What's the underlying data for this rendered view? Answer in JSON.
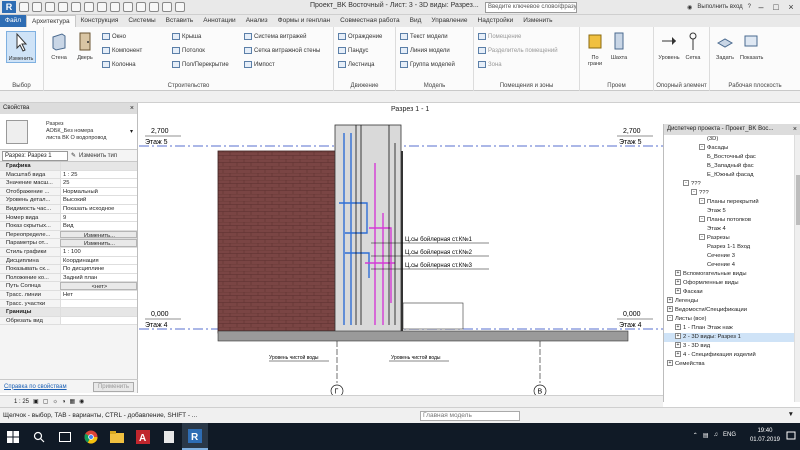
{
  "titlebar": {
    "title": "Проект_BK Восточный - Лист: 3 - 3D виды: Разрез...",
    "search_placeholder": "Введите ключевое слово/фразу",
    "user": "Выполнить вход"
  },
  "ribbon_tabs": [
    "Файл",
    "Архитектура",
    "Конструкция",
    "Системы",
    "Вставить",
    "Аннотации",
    "Анализ",
    "Формы и генплан",
    "Совместная работа",
    "Вид",
    "Управление",
    "Надстройки",
    "Изменить"
  ],
  "ribbon": {
    "modify_label": "Изменить",
    "select_group": "Выбор",
    "build_group": "Строительство",
    "circulation_group": "Движение",
    "model_group": "Модель",
    "room_group": "Помещения и зоны",
    "opening_group": "Проем",
    "datum_group": "Опорный элемент",
    "workplane_group": "Рабочая плоскость",
    "btn_wall": "Стена",
    "btn_door": "Дверь",
    "btn_window": "Окно",
    "btn_component": "Компонент",
    "btn_column": "Колонна",
    "btn_roof": "Крыша",
    "btn_ceiling": "Потолок",
    "btn_floor": "Пол/Перекрытие",
    "btn_curtain_system": "Система витражей",
    "btn_curtain_grid": "Сетка витражной стены",
    "btn_mullion": "Импост",
    "btn_railing": "Ограждение",
    "btn_ramp": "Пандус",
    "btn_stair": "Лестница",
    "btn_model_text": "Текст модели",
    "btn_model_line": "Линия модели",
    "btn_model_group": "Группа моделей",
    "btn_room": "Помещение",
    "btn_room_sep": "Разделитель помещений",
    "btn_area": "Зона",
    "btn_by_face": "По грани",
    "btn_shaft": "Шахта",
    "btn_level": "Уровень",
    "btn_grid": "Сетка",
    "btn_set": "Задать",
    "btn_show": "Показать"
  },
  "properties": {
    "palette_title": "Свойства",
    "type_name_1": "Разрез",
    "type_name_2": "АОБК_Без номера",
    "type_name_3": "листа ВК О водопровод",
    "filter_value": "Разрез: Разрез 1",
    "edit_type": "Изменить тип",
    "rows": [
      {
        "k": "Графика",
        "v": "",
        "cat": true
      },
      {
        "k": "Масштаб вида",
        "v": "1 : 25"
      },
      {
        "k": "Значение масш...",
        "v": "25"
      },
      {
        "k": "Отображение ...",
        "v": "Нормальный"
      },
      {
        "k": "Уровень детал...",
        "v": "Высокий"
      },
      {
        "k": "Видимость час...",
        "v": "Показать исходное"
      },
      {
        "k": "Номер вида",
        "v": "9"
      },
      {
        "k": "Показ скрытых...",
        "v": "Вид"
      },
      {
        "k": "Переопределе...",
        "v": "Изменить...",
        "btn": true
      },
      {
        "k": "Параметры от...",
        "v": "Изменить...",
        "btn": true
      },
      {
        "k": "Стиль графики",
        "v": "1 : 100"
      },
      {
        "k": "Дисциплина",
        "v": "Координация"
      },
      {
        "k": "Показывать ск...",
        "v": "По дисциплине"
      },
      {
        "k": "Положение ко...",
        "v": "Задний план"
      },
      {
        "k": "Путь Солнца",
        "v": "<нет>",
        "btn": true
      },
      {
        "k": "Трасс. линии",
        "v": "Нет"
      },
      {
        "k": "Трасс. участки",
        "v": ""
      },
      {
        "k": "Границы",
        "v": "",
        "cat": true
      },
      {
        "k": "Обрезать вид",
        "v": ""
      }
    ],
    "help": "Справка по свойствам",
    "apply": "Применить"
  },
  "drawing": {
    "view_title": "Разрез 1 - 1",
    "level_top": "2,700",
    "level_top_name": "Этаж 5",
    "level_bottom": "0,000",
    "level_bottom_name": "Этаж 4",
    "label_1": "Ц.сы бойлерная ст.К№1",
    "label_2": "Ц.сы бойлерная ст.К№2",
    "label_3": "Ц.сы бойлерная ст.К№3",
    "ground_left": "Уровень чистой воды",
    "ground_right": "Уровень чистой воды",
    "grid_A": "Г",
    "grid_B": "В"
  },
  "browser": {
    "title": "Диспетчер проекта - Проект_BK Вос...",
    "items": [
      {
        "t": "(3D)",
        "indent": 5
      },
      {
        "t": "Фасады",
        "indent": 4,
        "box": "-"
      },
      {
        "t": "Б_Восточный фас",
        "indent": 5
      },
      {
        "t": "В_Западный фас",
        "indent": 5
      },
      {
        "t": "Е_Южный фасад",
        "indent": 5
      },
      {
        "t": "???",
        "indent": 2,
        "box": "-"
      },
      {
        "t": "???",
        "indent": 3,
        "box": "-"
      },
      {
        "t": "Планы перекрытий",
        "indent": 4,
        "box": "-"
      },
      {
        "t": "Этаж 5",
        "indent": 5
      },
      {
        "t": "Планы потолков",
        "indent": 4,
        "box": "-"
      },
      {
        "t": "Этаж 4",
        "indent": 5
      },
      {
        "t": "Разрезы",
        "indent": 4,
        "box": "-"
      },
      {
        "t": "Разрез 1-1 Вход",
        "indent": 5
      },
      {
        "t": "Сечение 3",
        "indent": 5
      },
      {
        "t": "Сечение 4",
        "indent": 5
      },
      {
        "t": "Вспомогательные виды",
        "indent": 1,
        "box": "+"
      },
      {
        "t": "Оформленные виды",
        "indent": 1,
        "box": "+"
      },
      {
        "t": "Фаскаи",
        "indent": 1,
        "box": "+"
      },
      {
        "t": "Легенды",
        "indent": 0,
        "box": "+"
      },
      {
        "t": "Ведомости/Спецификации",
        "indent": 0,
        "box": "+"
      },
      {
        "t": "Листы (все)",
        "indent": 0,
        "box": "-"
      },
      {
        "t": "1 - План Этаж наж",
        "indent": 1,
        "box": "+"
      },
      {
        "t": "2 - 3D виды: Разрез 1",
        "indent": 1,
        "box": "+",
        "hl": true
      },
      {
        "t": "3 - 3D вид",
        "indent": 1,
        "box": "+"
      },
      {
        "t": "4 - Спецификация изделий",
        "indent": 1,
        "box": "+"
      },
      {
        "t": "Семейства",
        "indent": 0,
        "box": "+"
      }
    ]
  },
  "viewbar": {
    "scale": "1 : 25"
  },
  "status": {
    "hint": "Щелчок - выбор, TAB - варианты, CTRL - добавление, SHIFT - ...",
    "model": "Главная модель"
  },
  "taskbar": {
    "time": "19:40",
    "date": "01.07.2019",
    "lang": "ENG"
  },
  "colors": {
    "brick": "#7a4544",
    "brick_line": "#5a2e2e",
    "pipe_blue": "#2f6fd6",
    "pipe_magenta": "#d43ad6",
    "accent": "#2e6db4"
  }
}
